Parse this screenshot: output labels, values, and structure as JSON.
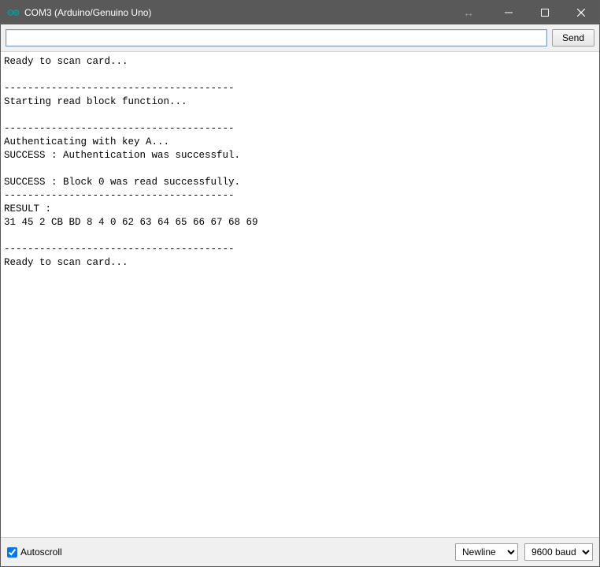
{
  "window": {
    "title": "COM3 (Arduino/Genuino Uno)"
  },
  "toolbar": {
    "input_value": "",
    "send_label": "Send"
  },
  "output": {
    "lines": [
      "Ready to scan card...",
      "",
      "---------------------------------------",
      "Starting read block function...",
      "",
      "---------------------------------------",
      "Authenticating with key A...",
      "SUCCESS : Authentication was successful.",
      "",
      "SUCCESS : Block 0 was read successfully.",
      "---------------------------------------",
      "RESULT :",
      "31 45 2 CB BD 8 4 0 62 63 64 65 66 67 68 69 ",
      "",
      "---------------------------------------",
      "Ready to scan card...",
      ""
    ]
  },
  "status": {
    "autoscroll_checked": true,
    "autoscroll_label": "Autoscroll",
    "line_ending_selected": "Newline",
    "baud_selected": "9600 baud"
  }
}
